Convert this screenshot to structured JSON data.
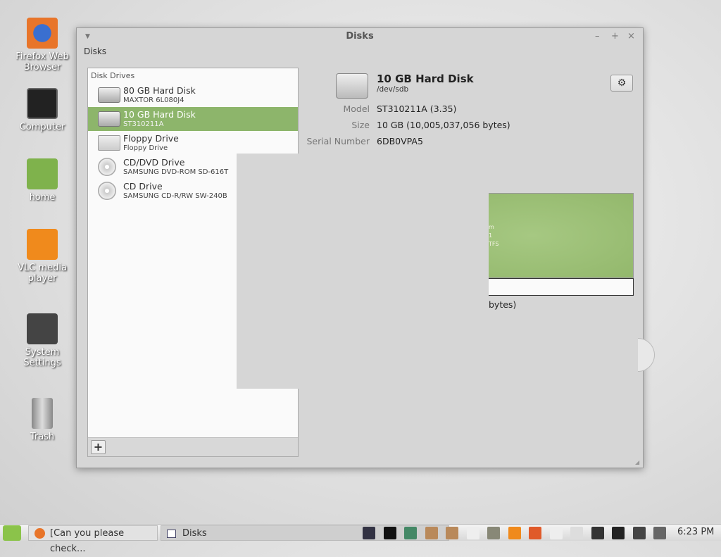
{
  "desktop": {
    "icons": [
      {
        "label": "Firefox Web Browser",
        "color": "#e8752a"
      },
      {
        "label": "Computer",
        "color": "#222"
      },
      {
        "label": "home",
        "color": "#7fb24c"
      },
      {
        "label": "VLC media player",
        "color": "#f08a1c"
      },
      {
        "label": "System Settings",
        "color": "#555"
      },
      {
        "label": "Trash",
        "color": "#999"
      }
    ]
  },
  "window": {
    "title": "Disks",
    "menu": "Disks",
    "sidebar": {
      "header": "Disk Drives",
      "items": [
        {
          "name": "80 GB Hard Disk",
          "sub": "MAXTOR 6L080J4",
          "type": "hdd"
        },
        {
          "name": "10 GB Hard Disk",
          "sub": "ST310211A",
          "type": "hdd",
          "selected": true
        },
        {
          "name": "Floppy Drive",
          "sub": "Floppy Drive",
          "type": "floppy"
        },
        {
          "name": "CD/DVD Drive",
          "sub": "SAMSUNG DVD-ROM SD-616T",
          "type": "cd"
        },
        {
          "name": "CD Drive",
          "sub": "SAMSUNG CD-R/RW SW-240B",
          "type": "cd"
        }
      ],
      "add_label": "+"
    },
    "detail": {
      "title": "10 GB Hard Disk",
      "device": "/dev/sdb",
      "model_label": "Model",
      "model": "ST310211A (3.35)",
      "size_label": "Size",
      "size": "10 GB (10,005,037,056 bytes)",
      "serial_label": "Serial Number",
      "serial": "6DB0VPA5",
      "partition_frag": [
        "m",
        "1",
        "TFS"
      ],
      "bytes_frag": "bytes)"
    }
  },
  "taskbar": {
    "tasks": [
      "[Can you please check...",
      "Disks"
    ],
    "clock": "6:23 PM"
  }
}
